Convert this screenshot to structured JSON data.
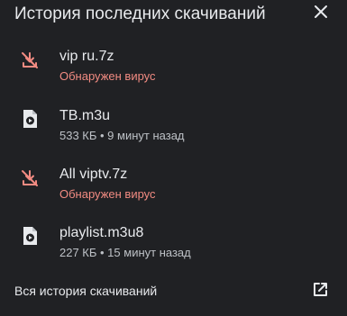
{
  "header": {
    "title": "История последних скачиваний",
    "close_icon": "close-icon"
  },
  "downloads": [
    {
      "name": "vip ru.7z",
      "status": "Обнаружен вирус",
      "icon": "blocked-download-icon",
      "state": "danger"
    },
    {
      "name": "TB.m3u",
      "status": "533 КБ • 9 минут назад",
      "icon": "media-file-icon",
      "state": "ok"
    },
    {
      "name": "All viptv.7z",
      "status": "Обнаружен вирус",
      "icon": "blocked-download-icon",
      "state": "danger"
    },
    {
      "name": "playlist.m3u8",
      "status": "227 КБ • 15 минут назад",
      "icon": "media-file-icon",
      "state": "ok"
    }
  ],
  "footer": {
    "history_label": "Вся история скачиваний",
    "open_icon": "open-in-new-icon"
  },
  "colors": {
    "background": "#202124",
    "text_primary": "#e8eaed",
    "text_secondary": "#bdc1c6",
    "danger": "#f28b82"
  }
}
